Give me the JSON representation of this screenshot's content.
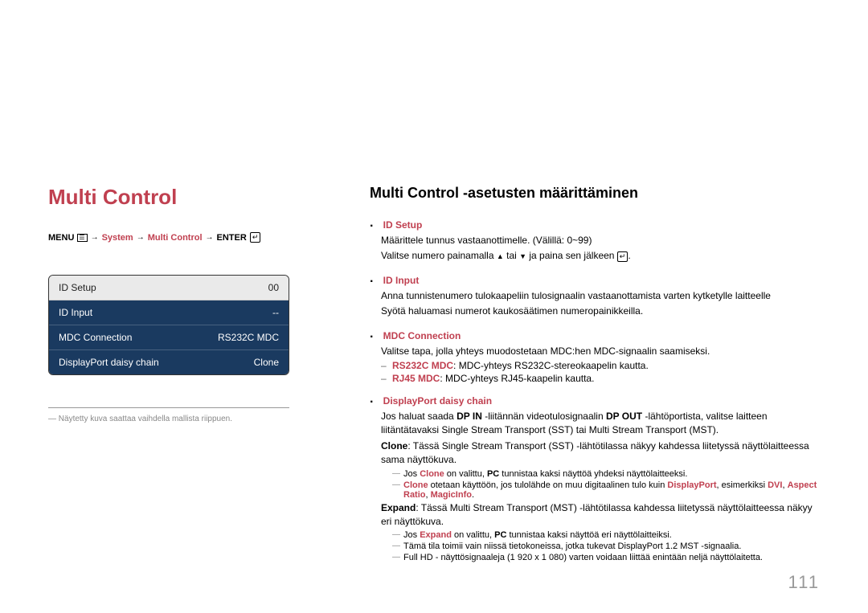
{
  "left": {
    "title": "Multi Control",
    "breadcrumb": {
      "menu": "MENU",
      "system": "System",
      "multicontrol": "Multi Control",
      "enter": "ENTER"
    },
    "panel": {
      "row1_label": "ID Setup",
      "row1_value": "00",
      "row2_label": "ID Input",
      "row2_value": "--",
      "row3_label": "MDC Connection",
      "row3_value": "RS232C MDC",
      "row4_label": "DisplayPort daisy chain",
      "row4_value": "Clone"
    },
    "footnote": "Näytetty kuva saattaa vaihdella mallista riippuen."
  },
  "right": {
    "section": "Multi Control -asetusten määrittäminen",
    "id_setup_head": "ID Setup",
    "id_setup_p1": "Määrittele tunnus vastaanottimelle. (Välillä: 0~99)",
    "id_setup_p2a": "Valitse numero painamalla ",
    "id_setup_p2b": " tai ",
    "id_setup_p2c": " ja paina sen jälkeen ",
    "id_setup_p2d": ".",
    "id_input_head": "ID Input",
    "id_input_p1": "Anna tunnistenumero tulokaapeliin tulosignaalin vastaanottamista varten kytketylle laitteelle",
    "id_input_p2": "Syötä haluamasi numerot kaukosäätimen numeropainikkeilla.",
    "mdc_head": "MDC Connection",
    "mdc_p1": "Valitse tapa, jolla yhteys muodostetaan MDC:hen MDC-signaalin saamiseksi.",
    "mdc_rs_head": "RS232C MDC",
    "mdc_rs_text": ": MDC-yhteys RS232C-stereokaapelin kautta.",
    "mdc_rj_head": "RJ45 MDC",
    "mdc_rj_text": ": MDC-yhteys RJ45-kaapelin kautta.",
    "dp_head": "DisplayPort daisy chain",
    "dp_p1a": "Jos haluat saada ",
    "dp_p1b_bold": "DP IN",
    "dp_p1c": " -liitännän videotulosignaalin ",
    "dp_p1d_bold": "DP OUT",
    "dp_p1e": " -lähtöportista, valitse laitteen liitäntätavaksi Single Stream Transport (SST) tai Multi Stream Transport (MST).",
    "clone_bold": "Clone",
    "clone_text": ": Tässä Single Stream Transport (SST) -lähtötilassa näkyy kahdessa liitetyssä näyttölaitteessa sama näyttökuva.",
    "clone_sub1a": "Jos ",
    "clone_sub1b": "Clone",
    "clone_sub1c": " on valittu, ",
    "clone_sub1d": "PC",
    "clone_sub1e": " tunnistaa kaksi näyttöä yhdeksi näyttölaitteeksi.",
    "clone_sub2a": "Clone",
    "clone_sub2b": " otetaan käyttöön, jos tulolähde on muu digitaalinen tulo kuin ",
    "clone_sub2c": "DisplayPort",
    "clone_sub2d": ", esimerkiksi ",
    "clone_sub2e": "DVI",
    "clone_sub2f": ", ",
    "clone_sub2g": "Aspect Ratio",
    "clone_sub2h": ", ",
    "clone_sub2i": "MagicInfo",
    "clone_sub2j": ".",
    "expand_bold": "Expand",
    "expand_text": ": Tässä Multi Stream Transport (MST) -lähtötilassa kahdessa liitetyssä näyttölaitteessa näkyy eri näyttökuva.",
    "expand_sub1a": "Jos ",
    "expand_sub1b": "Expand",
    "expand_sub1c": " on valittu, ",
    "expand_sub1d": "PC",
    "expand_sub1e": " tunnistaa kaksi näyttöä eri näyttölaitteiksi.",
    "expand_sub2": "Tämä tila toimii vain niissä tietokoneissa, jotka tukevat DisplayPort 1.2 MST -signaalia.",
    "expand_sub3": "Full HD - näyttösignaaleja (1 920 x 1 080) varten voidaan liittää enintään neljä näyttölaitetta."
  },
  "page_number": "111"
}
